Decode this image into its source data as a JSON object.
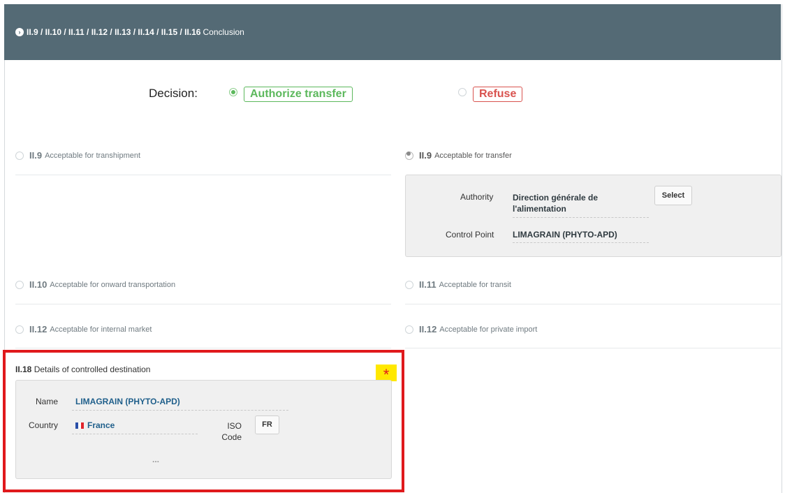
{
  "header": {
    "sections": "II.9 / II.10 / II.11 / II.12 / II.13 / II.14 / II.15 / II.16",
    "title": "Conclusion"
  },
  "decision": {
    "label": "Decision:",
    "authorize": "Authorize transfer",
    "refuse": "Refuse",
    "selected": "Authorize transfer"
  },
  "options": {
    "transhipment": {
      "code": "II.9",
      "label": "Acceptable for transhipment"
    },
    "transfer": {
      "code": "II.9",
      "label": "Acceptable for transfer"
    },
    "onward": {
      "code": "II.10",
      "label": "Acceptable for onward transportation"
    },
    "transit": {
      "code": "II.11",
      "label": "Acceptable for transit"
    },
    "internal_market": {
      "code": "II.12",
      "label": "Acceptable for internal market"
    },
    "private_import": {
      "code": "II.12",
      "label": "Acceptable for private import"
    }
  },
  "transfer_panel": {
    "authority_label": "Authority",
    "authority_value": "Direction générale de l'alimentation",
    "select_button": "Select",
    "control_point_label": "Control Point",
    "control_point_value": "LIMAGRAIN (PHYTO-APD)"
  },
  "controlled_destination": {
    "code": "II.18",
    "title": "Details of controlled destination",
    "required_mark": "*",
    "name_label": "Name",
    "name_value": "LIMAGRAIN (PHYTO-APD)",
    "country_label": "Country",
    "country_value": "France",
    "iso_label": "ISO Code",
    "iso_value": "FR",
    "more": "..."
  },
  "colors": {
    "header_bg": "#546a75",
    "authorize": "#5cb85c",
    "refuse": "#d9534f",
    "highlight": "#e0191c",
    "required_bg": "#ffe800"
  }
}
